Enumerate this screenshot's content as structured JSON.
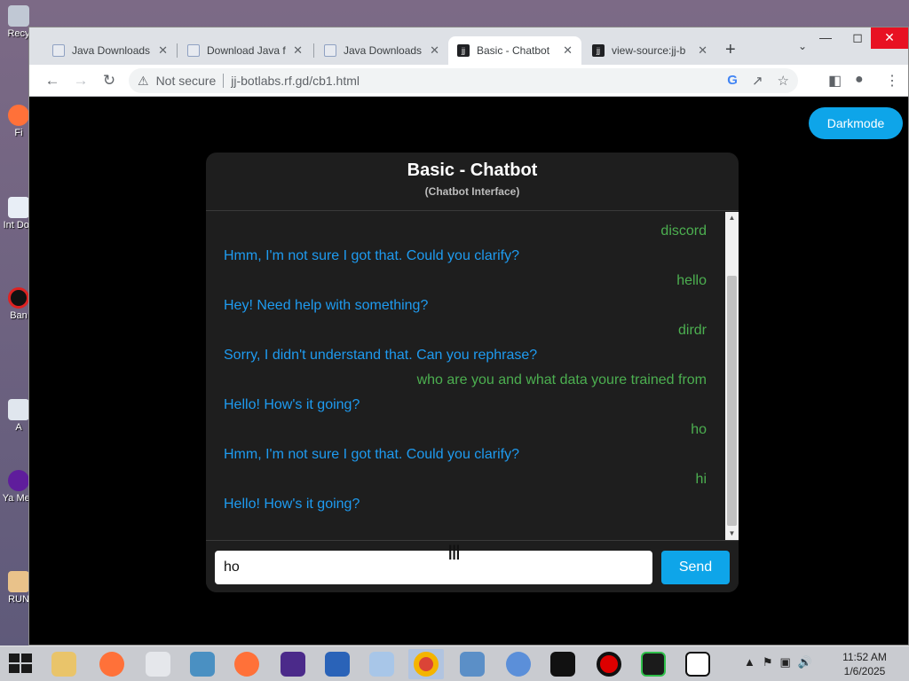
{
  "desktop": {
    "icons": [
      {
        "label": "Recy"
      },
      {
        "label": "Fi"
      },
      {
        "label": "Int Dov"
      },
      {
        "label": "Ban"
      },
      {
        "label": "A"
      },
      {
        "label": "Ya Mes"
      },
      {
        "label": "RUN"
      }
    ]
  },
  "browser": {
    "tabs": [
      {
        "title": "Java Downloads",
        "favicon": "java-icon"
      },
      {
        "title": "Download Java f",
        "favicon": "java-icon"
      },
      {
        "title": "Java Downloads",
        "favicon": "java-icon"
      },
      {
        "title": "Basic - Chatbot",
        "favicon": "jj-icon",
        "active": true
      },
      {
        "title": "view-source:jj-b",
        "favicon": "jj-icon"
      }
    ],
    "new_tab": "+",
    "tab_close": "✕",
    "omnibox": {
      "security": "Not secure",
      "url": "jj-botlabs.rf.gd/cb1.html"
    }
  },
  "page": {
    "darkmode_label": "Darkmode",
    "chat": {
      "title": "Basic - Chatbot",
      "subtitle": "(Chatbot Interface)",
      "messages": [
        {
          "sender": "user",
          "text": "discord"
        },
        {
          "sender": "bot",
          "text": "Hmm, I'm not sure I got that. Could you clarify?"
        },
        {
          "sender": "user",
          "text": "hello"
        },
        {
          "sender": "bot",
          "text": "Hey! Need help with something?"
        },
        {
          "sender": "user",
          "text": "dirdr"
        },
        {
          "sender": "bot",
          "text": "Sorry, I didn't understand that. Can you rephrase?"
        },
        {
          "sender": "user",
          "text": "who are you and what data youre trained from"
        },
        {
          "sender": "bot",
          "text": "Hello! How's it going?"
        },
        {
          "sender": "user",
          "text": "ho"
        },
        {
          "sender": "bot",
          "text": "Hmm, I'm not sure I got that. Could you clarify?"
        },
        {
          "sender": "user",
          "text": "hi"
        },
        {
          "sender": "bot",
          "text": "Hello! How's it going?"
        }
      ],
      "input_value": "ho",
      "send_label": "Send"
    }
  },
  "taskbar": {
    "clock_time": "11:52 AM",
    "clock_date": "1/6/2025",
    "apps": [
      "file-explorer",
      "firefox",
      "runner",
      "remote-desktop",
      "firefox",
      "cpu-tool",
      "powershell",
      "media-player",
      "chrome",
      "control-panel",
      "chromium",
      "cmd",
      "recorder",
      "terminal",
      "7zip"
    ]
  },
  "colors": {
    "bot_text": "#1e9bf0",
    "user_text": "#4caf50",
    "accent": "#0ea5e9",
    "chat_bg": "#1e1e1e"
  }
}
